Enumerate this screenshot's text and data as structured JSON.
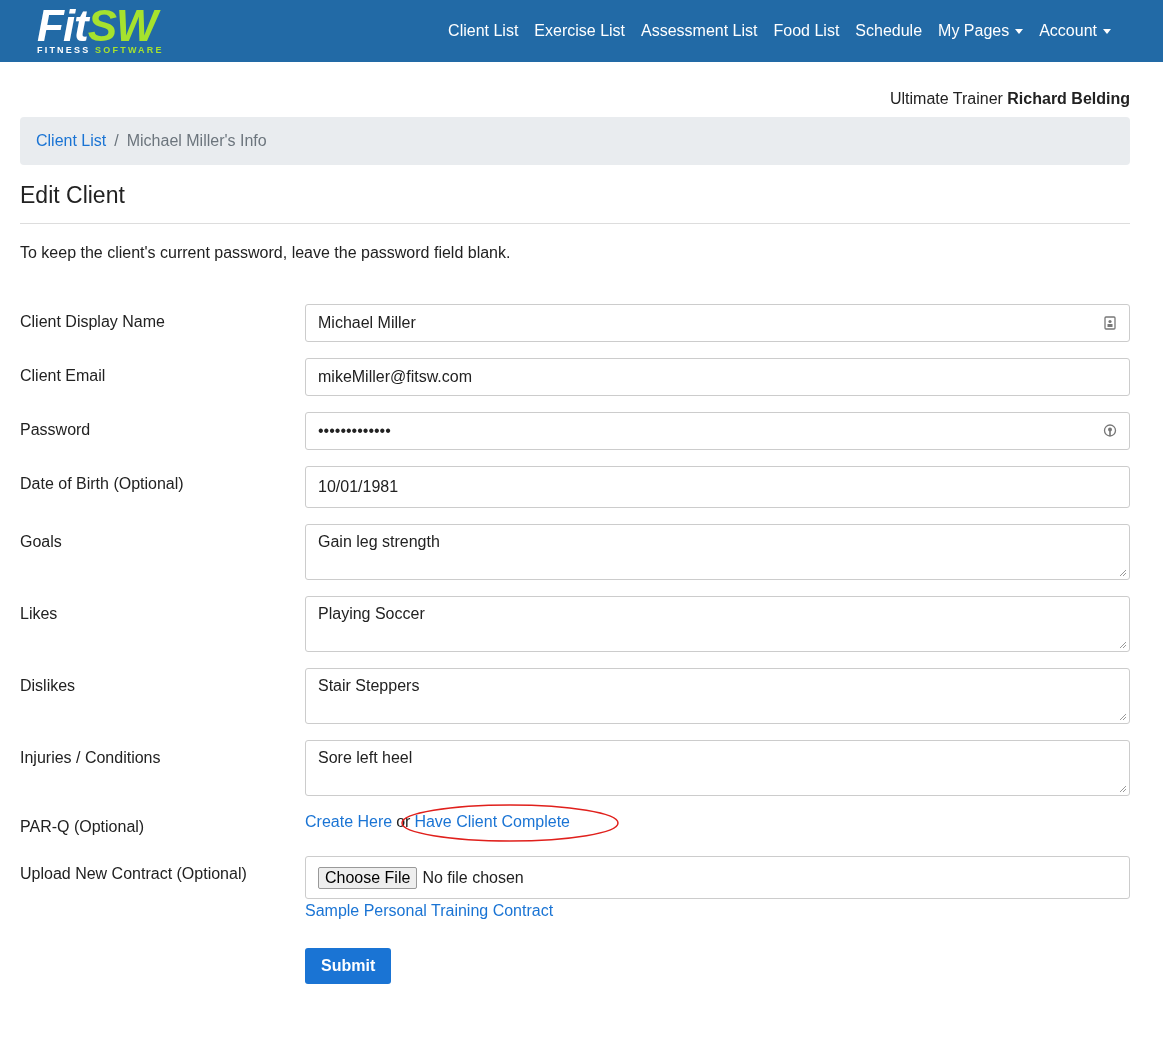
{
  "logo": {
    "word_white": "Fit",
    "word_green": "SW",
    "tag_white": "FITNESS",
    "tag_green": "SOFTWARE"
  },
  "nav": [
    {
      "label": "Client List",
      "dropdown": false
    },
    {
      "label": "Exercise List",
      "dropdown": false
    },
    {
      "label": "Assessment List",
      "dropdown": false
    },
    {
      "label": "Food List",
      "dropdown": false
    },
    {
      "label": "Schedule",
      "dropdown": false
    },
    {
      "label": "My Pages",
      "dropdown": true
    },
    {
      "label": "Account",
      "dropdown": true
    }
  ],
  "user": {
    "role": "Ultimate Trainer",
    "name": "Richard Belding"
  },
  "breadcrumb": [
    {
      "label": "Client List",
      "link": true
    },
    {
      "label": "Michael Miller's Info",
      "link": false,
      "separator": "/"
    }
  ],
  "heading": "Edit Client",
  "note": "To keep the client's current password, leave the password field blank.",
  "fields": [
    {
      "kind": "input",
      "label": "Client Display Name",
      "value": "Michael Miller"
    },
    {
      "kind": "input",
      "label": "Client Email",
      "value": "mikeMiller@fitsw.com"
    },
    {
      "kind": "input",
      "label": "Password",
      "value": "•••••••••••••"
    },
    {
      "kind": "input",
      "label": "Date of Birth (Optional)",
      "value": "10/01/1981",
      "tall": true
    },
    {
      "kind": "textarea",
      "label": "Goals",
      "value": "Gain leg strength"
    },
    {
      "kind": "textarea",
      "label": "Likes",
      "value": "Playing Soccer"
    },
    {
      "kind": "textarea",
      "label": "Dislikes",
      "value": "Stair Steppers"
    },
    {
      "kind": "textarea",
      "label": "Injuries / Conditions",
      "value": "Sore left heel"
    },
    {
      "kind": "parq",
      "label": "PAR-Q (Optional)",
      "link_1": "Create Here",
      "joiner": "or",
      "link_2": "Have Client Complete",
      "circled": true
    },
    {
      "kind": "file",
      "label": "Upload New Contract (Optional)",
      "button": "Choose File",
      "status": "No file chosen",
      "link": "Sample Personal Training Contract"
    }
  ],
  "submit": "Submit"
}
